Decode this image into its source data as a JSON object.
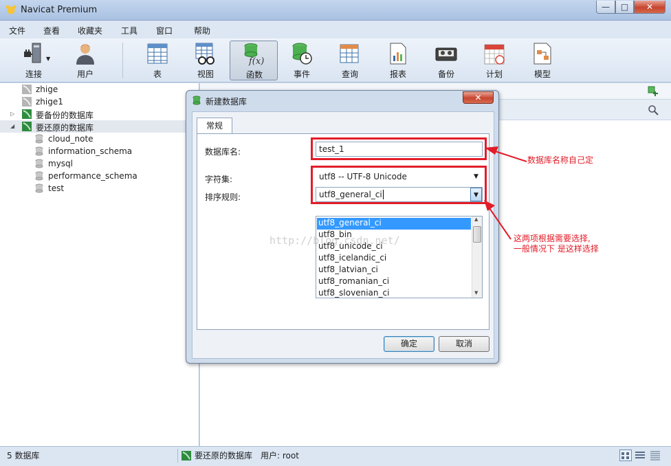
{
  "window": {
    "title": "Navicat Premium",
    "controls": {
      "min": "—",
      "max": "□",
      "close": "✕"
    }
  },
  "menu": [
    "文件",
    "查看",
    "收藏夹",
    "工具",
    "窗口",
    "帮助"
  ],
  "toolbar": {
    "items": [
      {
        "label": "连接",
        "icon": "plug-icon"
      },
      {
        "label": "用户",
        "icon": "user-icon"
      },
      {
        "label": "表",
        "icon": "table-icon"
      },
      {
        "label": "视图",
        "icon": "view-icon"
      },
      {
        "label": "函数",
        "icon": "function-icon",
        "active": true
      },
      {
        "label": "事件",
        "icon": "event-icon"
      },
      {
        "label": "查询",
        "icon": "query-icon"
      },
      {
        "label": "报表",
        "icon": "report-icon"
      },
      {
        "label": "备份",
        "icon": "backup-icon"
      },
      {
        "label": "计划",
        "icon": "schedule-icon"
      },
      {
        "label": "模型",
        "icon": "model-icon"
      }
    ],
    "function_icon_text": "f(x)"
  },
  "tree": {
    "connections": [
      {
        "label": "zhige"
      },
      {
        "label": "zhige1"
      },
      {
        "label": "要备份的数据库",
        "expander": "▷"
      },
      {
        "label": "要还原的数据库",
        "expander": "◢"
      }
    ],
    "databases": [
      "cloud_note",
      "information_schema",
      "mysql",
      "performance_schema",
      "test"
    ]
  },
  "dialog": {
    "title": "新建数据库",
    "close": "✕",
    "tab": "常规",
    "labels": {
      "name": "数据库名:",
      "charset": "字符集:",
      "collation": "排序规则:"
    },
    "name_value": "test_1",
    "charset_value": "utf8 -- UTF-8 Unicode",
    "collation_value": "utf8_general_ci",
    "collation_options": [
      "utf8_general_ci",
      "utf8_bin",
      "utf8_unicode_ci",
      "utf8_icelandic_ci",
      "utf8_latvian_ci",
      "utf8_romanian_ci",
      "utf8_slovenian_ci"
    ],
    "ok": "确定",
    "cancel": "取消"
  },
  "annotations": {
    "name_note": "数据库名称自己定",
    "charset_note_1": "这两项根据需要选择,",
    "charset_note_2": "一般情况下 是这样选择"
  },
  "watermark": "http://blog.csdn.net/",
  "status": {
    "count": "5 数据库",
    "connection": "要还原的数据库",
    "user": "用户: root"
  },
  "colors": {
    "annotation": "#e21c28",
    "selection": "#3399ff",
    "db_icon": "#2e8b3e"
  }
}
